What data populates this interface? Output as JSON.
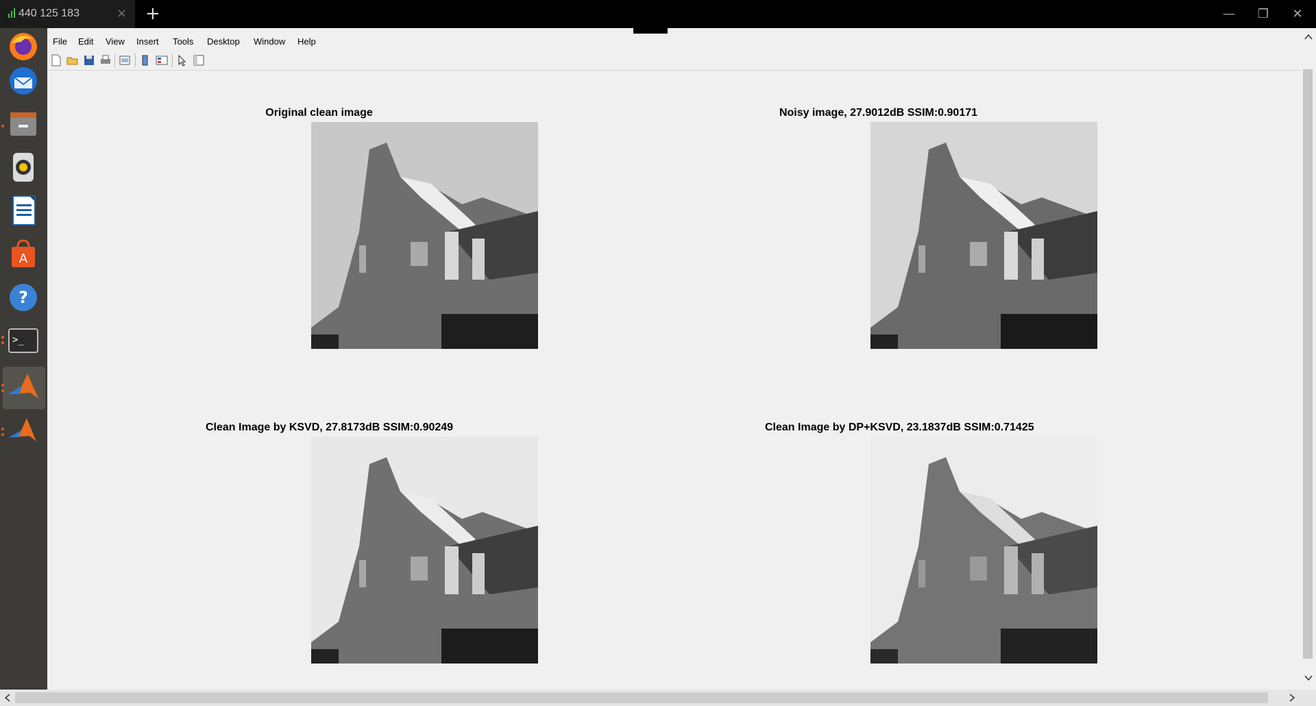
{
  "remote_tab": {
    "title": "440 125 183",
    "close_glyph": "×",
    "new_tab_glyph": "+"
  },
  "window_controls": {
    "minimize": "—",
    "restore": "❐",
    "close": "✕"
  },
  "dock": {
    "items": [
      {
        "name": "firefox-icon"
      },
      {
        "name": "thunderbird-icon"
      },
      {
        "name": "files-icon"
      },
      {
        "name": "rhythmbox-icon"
      },
      {
        "name": "libreoffice-writer-icon"
      },
      {
        "name": "software-center-icon"
      },
      {
        "name": "help-icon"
      },
      {
        "name": "terminal-icon"
      },
      {
        "name": "matlab-icon"
      },
      {
        "name": "matlab-icon"
      }
    ]
  },
  "menu": {
    "items": [
      {
        "label": "File"
      },
      {
        "label": "Edit"
      },
      {
        "label": "View"
      },
      {
        "label": "Insert"
      },
      {
        "label": "Tools"
      },
      {
        "label": "Desktop"
      },
      {
        "label": "Window"
      },
      {
        "label": "Help"
      }
    ]
  },
  "toolbar": {
    "icons": [
      "new-figure-icon",
      "open-icon",
      "save-icon",
      "print-icon",
      "link-plot-icon",
      "insert-colorbar-icon",
      "insert-legend-icon",
      "select-pointer-icon",
      "property-inspector-icon"
    ]
  },
  "figure": {
    "panels": [
      {
        "title": "Original clean image"
      },
      {
        "title": "Noisy image, 27.9012dB SSIM:0.90171"
      },
      {
        "title": "Clean Image by KSVD, 27.8173dB SSIM:0.90249"
      },
      {
        "title": "Clean Image by DP+KSVD, 23.1837dB SSIM:0.71425"
      }
    ]
  },
  "collapse_toggle": "⌄",
  "colors": {
    "tabbar_bg": "#000000",
    "dock_bg": "#3c3b37",
    "figure_bg": "#f0f0f0",
    "accent": "#e95420"
  }
}
